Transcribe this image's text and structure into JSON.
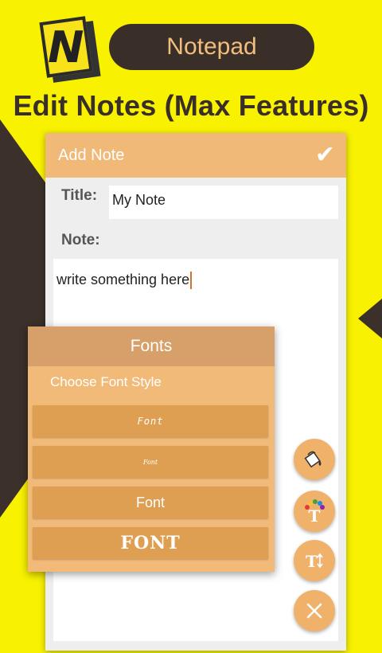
{
  "promo": {
    "logo_letter": "N",
    "app_name": "Notepad",
    "headline": "Edit Notes (Max Features)"
  },
  "screen": {
    "appbar_title": "Add Note",
    "title_label": "Title:",
    "title_value": "My Note",
    "note_label": "Note:",
    "note_text": "write something here"
  },
  "font_dialog": {
    "title": "Fonts",
    "subtitle": "Choose Font Style",
    "options": [
      "Font",
      "Font",
      "Font",
      "FONT"
    ]
  },
  "fab_icons": [
    "paint-bucket-icon",
    "text-color-icon",
    "text-size-icon",
    "close-icon"
  ],
  "colors": {
    "background": "#f8f200",
    "dark": "#3a2f28",
    "accent": "#f0b977",
    "dialog_header": "#d7a06a",
    "option_button": "#de9f52"
  }
}
